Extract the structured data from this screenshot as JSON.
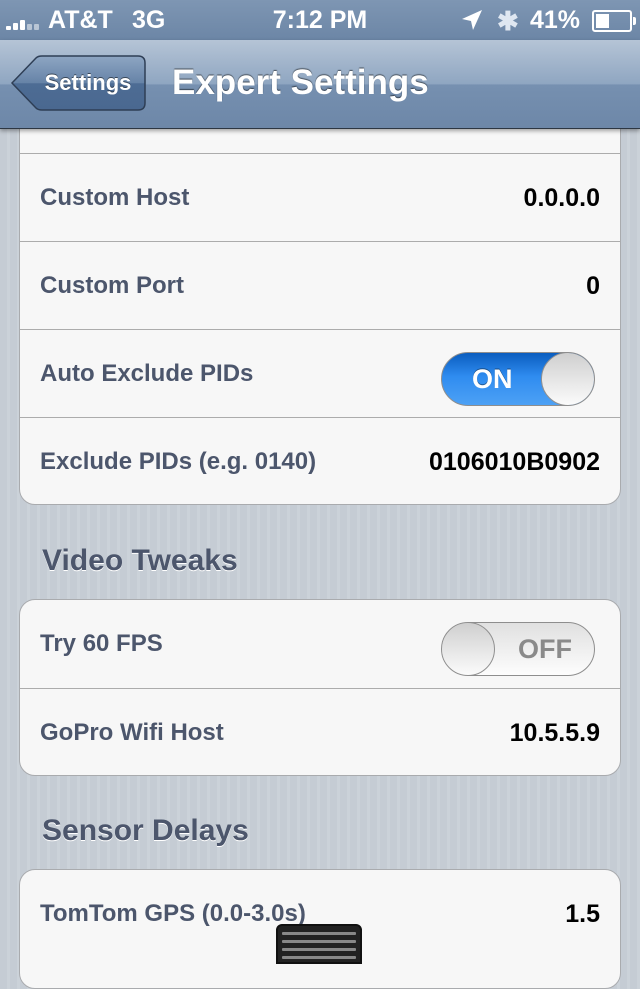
{
  "status_bar": {
    "carrier": "AT&T",
    "network": "3G",
    "time": "7:12 PM",
    "battery_percent": "41%",
    "battery_level": 0.41,
    "icons": [
      "signal-icon",
      "location-icon",
      "bluetooth-icon",
      "battery-icon"
    ]
  },
  "nav": {
    "back_label": "Settings",
    "title": "Expert Settings"
  },
  "group1": {
    "rows": [
      {
        "label": "Custom Host",
        "value": "0.0.0.0"
      },
      {
        "label": "Custom Port",
        "value": "0"
      },
      {
        "label": "Auto Exclude PIDs",
        "switch_text": "ON",
        "switch_on": true
      },
      {
        "label": "Exclude PIDs (e.g. 0140)",
        "value": "0106010B0902"
      }
    ]
  },
  "video_tweaks": {
    "header": "Video Tweaks",
    "rows": [
      {
        "label": "Try 60 FPS",
        "switch_text": "OFF",
        "switch_on": false
      },
      {
        "label": "GoPro Wifi Host",
        "value": "10.5.5.9"
      }
    ]
  },
  "sensor_delays": {
    "header": "Sensor Delays",
    "rows": [
      {
        "label": "TomTom GPS (0.0-3.0s)",
        "value": "1.5"
      }
    ]
  },
  "colors": {
    "accent_blue": "#2f8cf0",
    "label_text": "#4c566c",
    "navbar": "#6d87a8"
  }
}
